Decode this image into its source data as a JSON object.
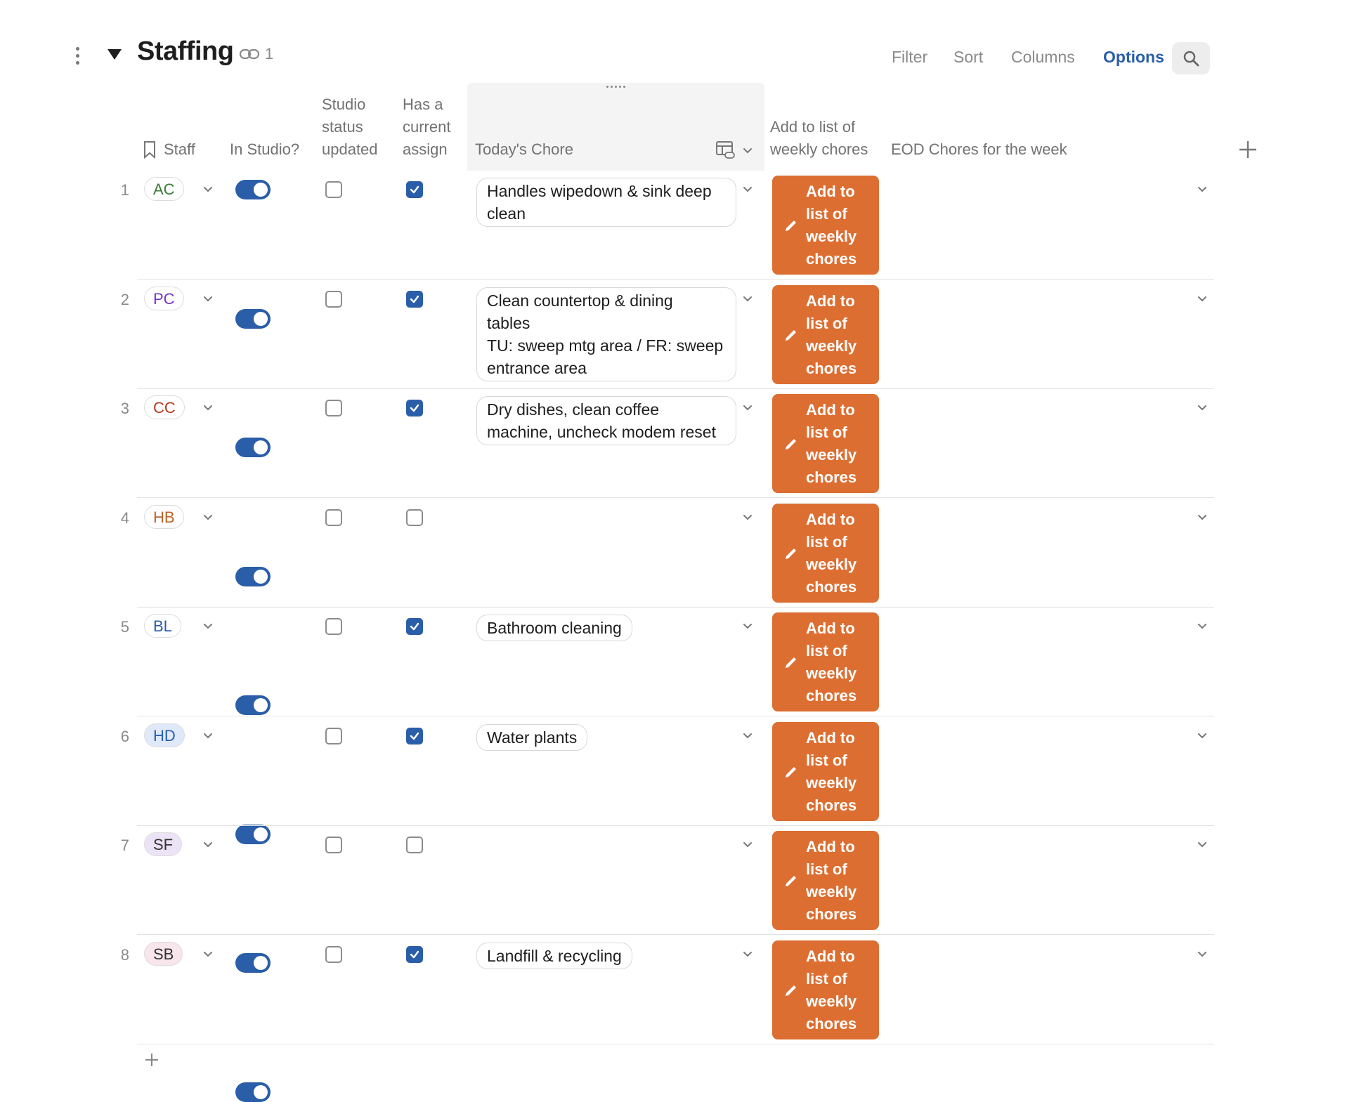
{
  "header": {
    "title": "Staffing",
    "link_count": "1",
    "toolbar": {
      "filter": "Filter",
      "sort": "Sort",
      "columns": "Columns",
      "options": "Options"
    }
  },
  "columns": {
    "staff": "Staff",
    "in_studio": "In Studio?",
    "studio_status_l1": "Studio",
    "studio_status_l2": "status",
    "studio_status_l3": "updated",
    "has_assign_l1": "Has a",
    "has_assign_l2": "current",
    "has_assign_l3": "assign",
    "todays_chore": "Today's Chore",
    "add_weekly_l1": "Add to list of",
    "add_weekly_l2": "weekly chores",
    "eod_chores": "EOD Chores for the week"
  },
  "action_button": {
    "l1": "Add to",
    "l2": "list of",
    "l3": "weekly",
    "l4": "chores"
  },
  "colors": {
    "accent": "#2a5ea8",
    "action": "#dd6e31"
  },
  "rows": [
    {
      "num": "1",
      "initials": "AC",
      "color": "#3c7a38",
      "bg": "#ffffff",
      "in_studio": true,
      "status_updated": false,
      "has_assign": true,
      "chore": [
        "Handles wipedown & sink deep",
        "clean"
      ]
    },
    {
      "num": "2",
      "initials": "PC",
      "color": "#7a33c0",
      "bg": "#ffffff",
      "in_studio": true,
      "status_updated": false,
      "has_assign": true,
      "chore": [
        "Clean countertop & dining",
        "tables",
        "TU: sweep mtg area / FR: sweep",
        "entrance area"
      ]
    },
    {
      "num": "3",
      "initials": "CC",
      "color": "#b23a1e",
      "bg": "#ffffff",
      "in_studio": true,
      "status_updated": false,
      "has_assign": true,
      "chore": [
        "Dry dishes, clean coffee",
        "machine, uncheck modem reset"
      ]
    },
    {
      "num": "4",
      "initials": "HB",
      "color": "#c0622a",
      "bg": "#ffffff",
      "in_studio": true,
      "status_updated": false,
      "has_assign": false,
      "chore": []
    },
    {
      "num": "5",
      "initials": "BL",
      "color": "#2a5ea8",
      "bg": "#ffffff",
      "in_studio": true,
      "status_updated": false,
      "has_assign": true,
      "chore": [
        "Bathroom cleaning"
      ]
    },
    {
      "num": "6",
      "initials": "HD",
      "color": "#2a5ea8",
      "bg": "#dfe9fa",
      "in_studio": true,
      "status_updated": false,
      "has_assign": true,
      "chore": [
        "Water plants"
      ]
    },
    {
      "num": "7",
      "initials": "SF",
      "color": "#333333",
      "bg": "#ece3f6",
      "in_studio": true,
      "status_updated": false,
      "has_assign": false,
      "chore": []
    },
    {
      "num": "8",
      "initials": "SB",
      "color": "#333333",
      "bg": "#f8e6ec",
      "in_studio": true,
      "status_updated": false,
      "has_assign": true,
      "chore": [
        "Landfill & recycling"
      ]
    }
  ]
}
